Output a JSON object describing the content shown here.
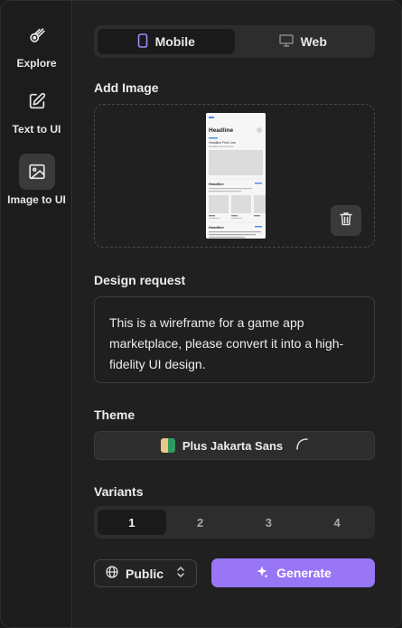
{
  "sidebar": {
    "items": [
      {
        "label": "Explore",
        "icon": "comet-icon"
      },
      {
        "label": "Text to UI",
        "icon": "edit-square-icon"
      },
      {
        "label": "Image to UI",
        "icon": "image-icon",
        "active": true
      }
    ]
  },
  "platform": {
    "options": [
      {
        "label": "Mobile",
        "icon": "phone-icon",
        "active": true
      },
      {
        "label": "Web",
        "icon": "monitor-icon",
        "active": false
      }
    ]
  },
  "add_image": {
    "label": "Add Image",
    "preview": {
      "headline": "Headline",
      "line1": "Headline First Line",
      "line2": "Headline Second Line",
      "section1": "Headline",
      "section2": "Headline"
    }
  },
  "design_request": {
    "label": "Design request",
    "value": "This is a wireframe for a game app marketplace, please convert it into a high-fidelity UI design."
  },
  "theme": {
    "label": "Theme",
    "font_name": "Plus Jakarta Sans",
    "swatch_colors": [
      "#e8c88a",
      "#2f9a5f"
    ]
  },
  "variants": {
    "label": "Variants",
    "options": [
      "1",
      "2",
      "3",
      "4"
    ],
    "selected": "1"
  },
  "visibility": {
    "label": "Public"
  },
  "generate": {
    "label": "Generate",
    "color": "#9876f5"
  }
}
